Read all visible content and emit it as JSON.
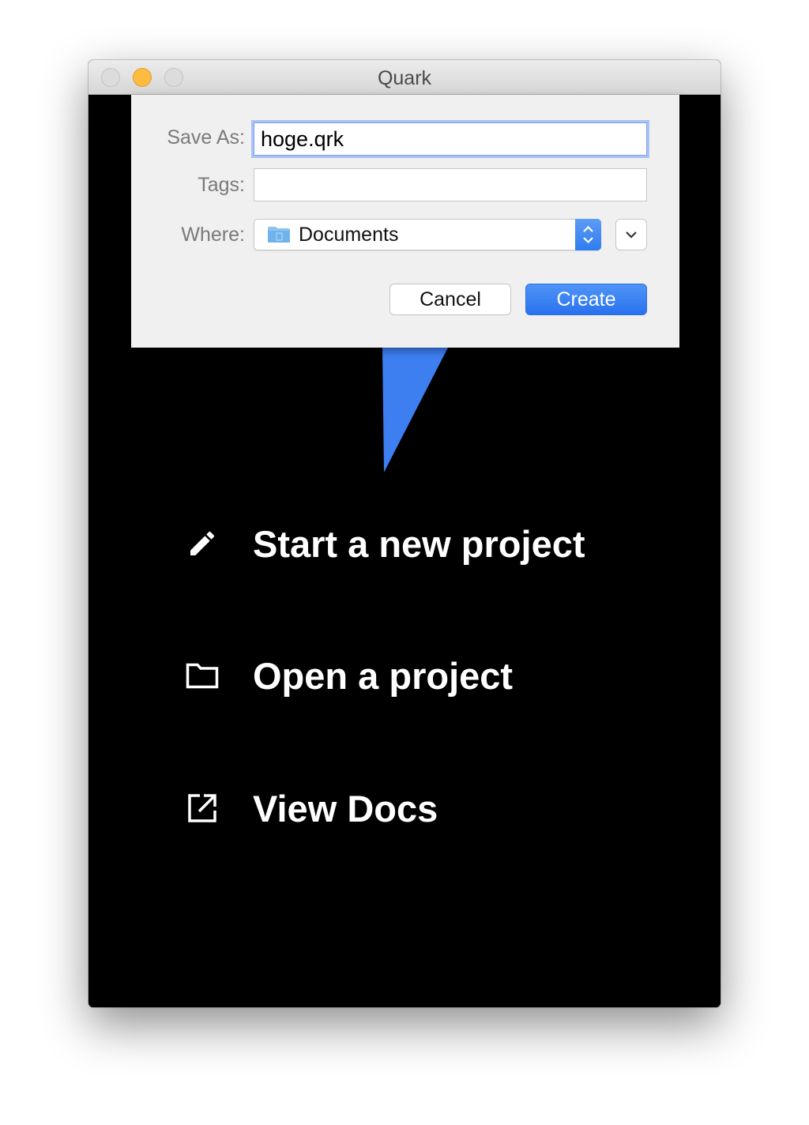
{
  "window": {
    "title": "Quark"
  },
  "save_sheet": {
    "save_as_label": "Save As:",
    "save_as_value": "hoge.qrk",
    "tags_label": "Tags:",
    "tags_value": "",
    "where_label": "Where:",
    "where_value": "Documents",
    "where_icon": "folder-icon",
    "cancel_label": "Cancel",
    "create_label": "Create",
    "accent_color": "#2f7cf0"
  },
  "menu": {
    "items": [
      {
        "icon": "pencil-icon",
        "label": "Start a new project"
      },
      {
        "icon": "folder-icon",
        "label": "Open a project"
      },
      {
        "icon": "external-link-icon",
        "label": "View Docs"
      }
    ]
  },
  "logo": {
    "color": "#3d7ef0"
  }
}
